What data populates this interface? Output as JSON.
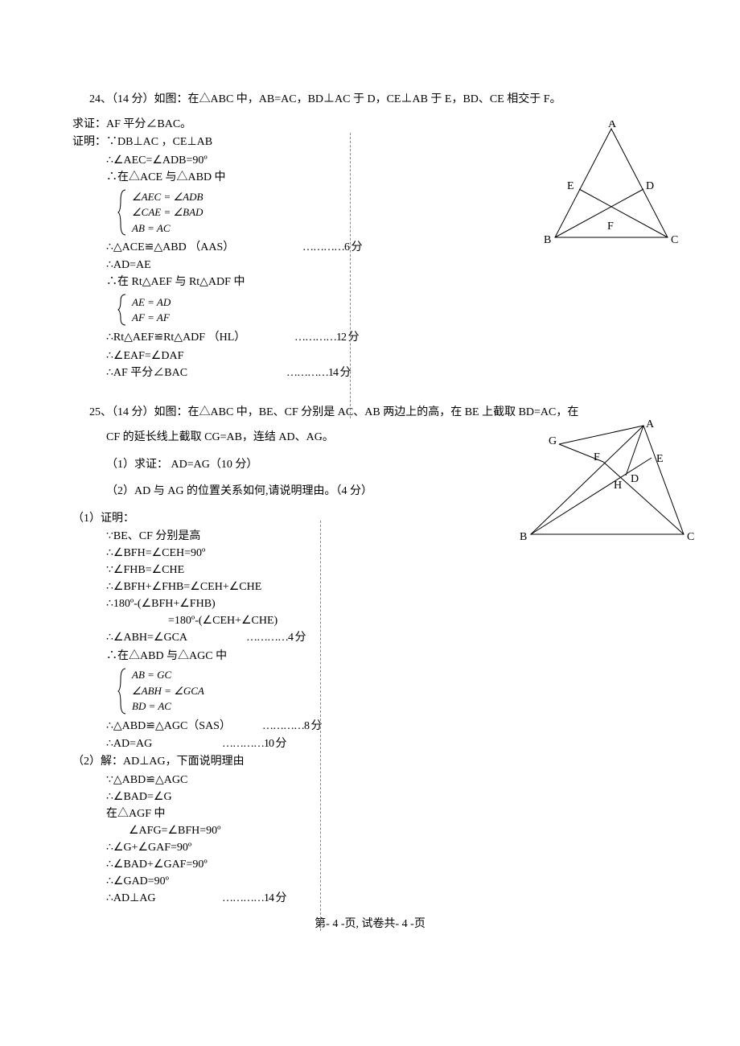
{
  "problem24": {
    "number": "24、",
    "points": "（14 分）",
    "stem": "如图：在△ABC 中，AB=AC，BD⊥AC 于 D，CE⊥AB 于 E，BD、CE 相交于 F。",
    "ask": "求证：AF 平分∠BAC。",
    "proof_label": "证明：",
    "lines": {
      "l1": "∵DB⊥AC ，CE⊥AB",
      "l2": "∴∠AEC=∠ADB=90º",
      "l3": "∴在△ACE 与△ABD 中",
      "b1a": "∠AEC = ∠ADB",
      "b1b": "∠CAE = ∠BAD",
      "b1c": "AB = AC",
      "l4": "∴△ACE≌△ABD （AAS）",
      "l4_score": "…………6 分",
      "l5": "∴AD=AE",
      "l6": "∴在 Rt△AEF 与 Rt△ADF 中",
      "b2a": "AE = AD",
      "b2b": "AF = AF",
      "l7": "∴Rt△AEF≌Rt△ADF （HL）",
      "l7_score": "…………12 分",
      "l8": "∴∠EAF=∠DAF",
      "l9": "∴AF 平分∠BAC",
      "l9_score": "…………14 分"
    },
    "figure": {
      "A": "A",
      "B": "B",
      "C": "C",
      "D": "D",
      "E": "E",
      "F": "F"
    }
  },
  "problem25": {
    "number": "25、",
    "points": "（14 分）",
    "stem1": "如图：在△ABC 中，BE、CF 分别是 AC、AB 两边上的高，在 BE 上截取 BD=AC，在",
    "stem2": "CF 的延长线上截取 CG=AB，连结 AD、AG。",
    "q1": "（1）求证：  AD=AG（10 分）",
    "q2": "（2）AD 与 AG 的位置关系如何,请说明理由。（4 分）",
    "part1_label": "（1）证明：",
    "p1_lines": {
      "l1": "∵BE、CF 分别是高",
      "l2": "∴∠BFH=∠CEH=90º",
      "l3": "∵∠FHB=∠CHE",
      "l4": "∴∠BFH+∠FHB=∠CEH+∠CHE",
      "l5": "∴180º-(∠BFH+∠FHB)",
      "l5b": "=180º-(∠CEH+∠CHE)",
      "l6": "∴∠ABH=∠GCA",
      "l6_score": "…………4 分",
      "l7": "∴在△ABD 与△AGC 中",
      "b1a": "AB = GC",
      "b1b": "∠ABH = ∠GCA",
      "b1c": "BD = AC",
      "l8": "∴△ABD≌△AGC（SAS）",
      "l8_score": "…………8 分",
      "l9": "∴AD=AG",
      "l9_score": "…………10 分"
    },
    "part2_label": "（2）解：AD⊥AG，下面说明理由",
    "p2_lines": {
      "l1": "∵△ABD≌△AGC",
      "l2": "∴∠BAD=∠G",
      "l3": "在△AGF 中",
      "l4": "∠AFG=∠BFH=90º",
      "l5": "∴∠G+∠GAF=90º",
      "l6": "∴∠BAD+∠GAF=90º",
      "l7": "∴∠GAD=90º",
      "l8": "∴AD⊥AG",
      "l8_score": "…………14 分"
    },
    "figure": {
      "A": "A",
      "B": "B",
      "C": "C",
      "D": "D",
      "E": "E",
      "F": "F",
      "G": "G",
      "H": "H"
    }
  },
  "footer": "第- 4 -页, 试卷共- 4 -页"
}
